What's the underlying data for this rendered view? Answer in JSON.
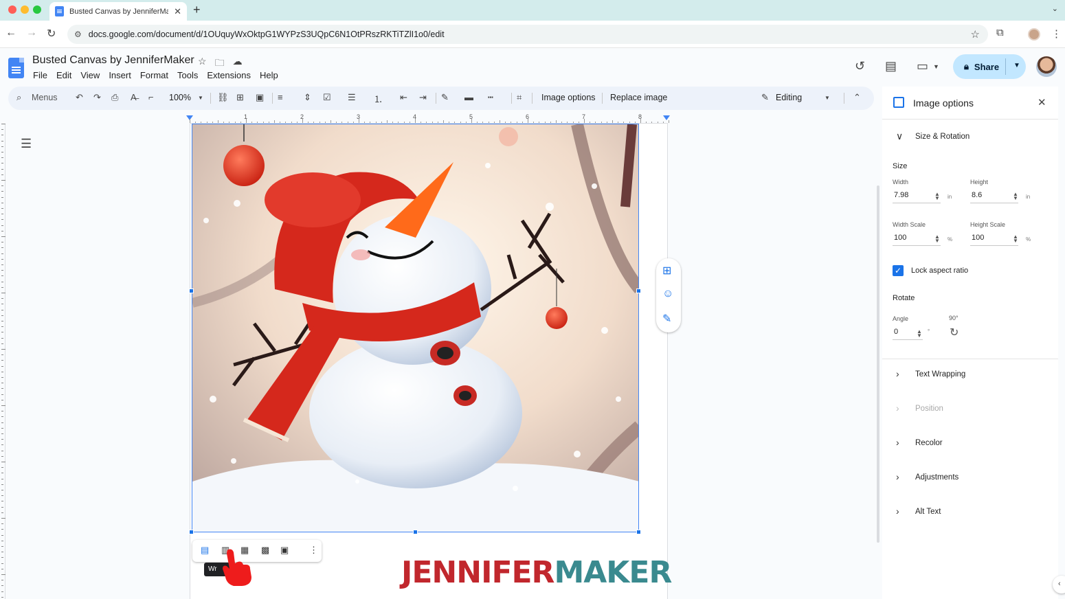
{
  "browser": {
    "tab_title": "Busted Canvas by JenniferMa",
    "url": "docs.google.com/document/d/1OUquyWxOktpG1WYPzS3UQpC6N1OtPRszRKTiTZlI1o0/edit"
  },
  "doc": {
    "title": "Busted Canvas by JenniferMaker",
    "menu": [
      "File",
      "Edit",
      "View",
      "Insert",
      "Format",
      "Tools",
      "Extensions",
      "Help"
    ],
    "share_label": "Share"
  },
  "toolbar": {
    "menus_label": "Menus",
    "zoom": "100%",
    "image_options": "Image options",
    "replace_image": "Replace image",
    "mode": "Editing"
  },
  "ruler": {
    "numbers": [
      "1",
      "2",
      "3",
      "4",
      "5",
      "6",
      "7",
      "8"
    ]
  },
  "wrap": {
    "tooltip": "Wr"
  },
  "watermark": {
    "part1": "JENNIFER",
    "part2": "MAKER"
  },
  "panel": {
    "title": "Image options",
    "size_rotation": "Size & Rotation",
    "size_head": "Size",
    "width_label": "Width",
    "width_value": "7.98",
    "width_unit": "in",
    "height_label": "Height",
    "height_value": "8.6",
    "height_unit": "in",
    "width_scale_label": "Width Scale",
    "width_scale_value": "100",
    "height_scale_label": "Height Scale",
    "height_scale_value": "100",
    "percent": "%",
    "lock_label": "Lock aspect ratio",
    "lock_checked": true,
    "rotate_head": "Rotate",
    "angle_label": "Angle",
    "angle_value": "0",
    "degree": "°",
    "rotate90_label": "90°",
    "sections": [
      "Text Wrapping",
      "Position",
      "Recolor",
      "Adjustments",
      "Alt Text"
    ]
  },
  "colors": {
    "accent": "#1a73e8",
    "share_bg": "#c2e7ff",
    "brand_red": "#c1272d",
    "brand_teal": "#3a8a8f"
  }
}
